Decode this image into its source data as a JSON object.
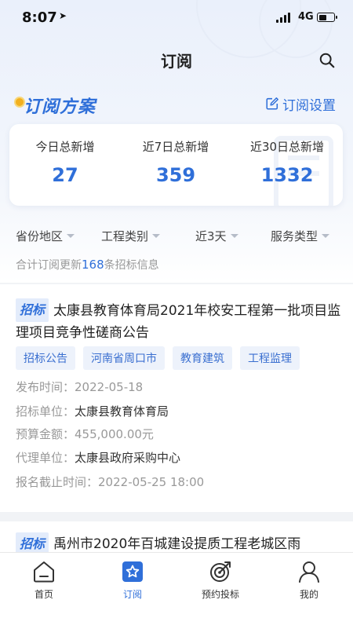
{
  "status_bar": {
    "time": "8:07",
    "network": "4G"
  },
  "header": {
    "title": "订阅"
  },
  "plan": {
    "title": "订阅方案",
    "settings_label": "订阅设置"
  },
  "stats": [
    {
      "label": "今日总新增",
      "value": "27"
    },
    {
      "label": "近7日总新增",
      "value": "359"
    },
    {
      "label": "近30日总新增",
      "value": "1332"
    }
  ],
  "filters": [
    "省份地区",
    "工程类别",
    "近3天",
    "服务类型"
  ],
  "summary": {
    "prefix": "合计订阅更新",
    "count": "168",
    "suffix": "条招标信息"
  },
  "listings": [
    {
      "type": "招标",
      "title": "太康县教育体育局2021年校安工程第一批项目监理项目竞争性磋商公告",
      "tags": [
        "招标公告",
        "河南省周口市",
        "教育建筑",
        "工程监理"
      ],
      "fields": [
        {
          "label": "发布时间：",
          "value": "2022-05-18"
        },
        {
          "label": "招标单位：",
          "value": "太康县教育体育局"
        },
        {
          "label": "预算金额：",
          "value": "455,000.00元"
        },
        {
          "label": "代理单位：",
          "value": "太康县政府采购中心"
        },
        {
          "label": "报名截止时间：",
          "value": "2022-05-25 18:00"
        }
      ]
    },
    {
      "type": "招标",
      "title": "禹州市2020年百城建设提质工程老城区雨"
    }
  ],
  "tabbar": [
    {
      "label": "首页",
      "icon": "home-icon"
    },
    {
      "label": "订阅",
      "icon": "star-icon",
      "active": true
    },
    {
      "label": "预约投标",
      "icon": "target-icon"
    },
    {
      "label": "我的",
      "icon": "user-icon"
    }
  ],
  "colors": {
    "accent": "#2f6fd9",
    "tag_bg": "#edf2fb"
  }
}
